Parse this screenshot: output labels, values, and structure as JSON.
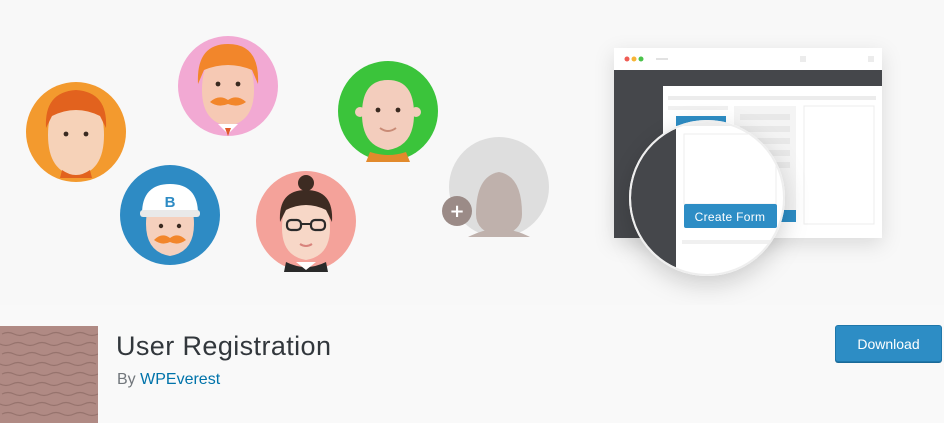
{
  "plugin": {
    "title": "User Registration",
    "author_prefix": "By",
    "author_name": "WPEverest",
    "download_label": "Download"
  },
  "banner": {
    "avatar_badge_b": "B",
    "add_symbol": "+",
    "create_form_label": "Create Form"
  },
  "colors": {
    "accent": "#2d8dc5",
    "avatar_orange": "#f39a2e",
    "avatar_pink": "#f2a9d3",
    "avatar_green": "#3bc43b",
    "avatar_blue": "#2e8bc4",
    "avatar_salmon": "#f4a29a",
    "avatar_grey": "#dedede"
  }
}
